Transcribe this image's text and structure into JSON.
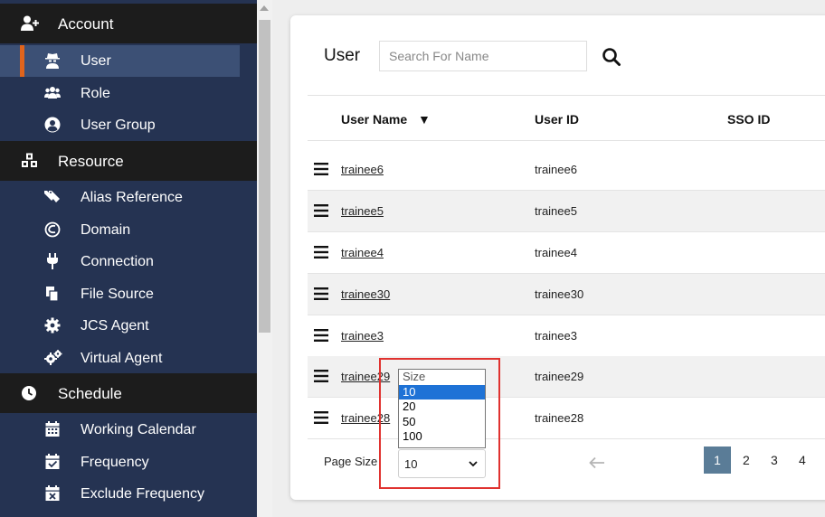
{
  "colors": {
    "sidebar": "#253352",
    "section_head": "#1c1c1c",
    "active_item": "#3c5075",
    "active_marker": "#e0641c",
    "page_active": "#5a7c97",
    "option_highlight": "#1e72d6",
    "annotation": "#e0322f"
  },
  "sidebar": {
    "sections": [
      {
        "label": "Account",
        "icon": "user-plus-icon"
      },
      {
        "label": "Resource",
        "icon": "cubes-icon"
      },
      {
        "label": "Schedule",
        "icon": "clock-icon"
      }
    ],
    "items": [
      {
        "label": "User",
        "icon": "user-secret-icon",
        "active": true
      },
      {
        "label": "Role",
        "icon": "users-icon"
      },
      {
        "label": "User Group",
        "icon": "user-circle-icon"
      },
      {
        "label": "Alias Reference",
        "icon": "tags-icon"
      },
      {
        "label": "Domain",
        "icon": "globe-icon"
      },
      {
        "label": "Connection",
        "icon": "plug-icon"
      },
      {
        "label": "File Source",
        "icon": "copy-icon"
      },
      {
        "label": "JCS Agent",
        "icon": "gear-icon"
      },
      {
        "label": "Virtual Agent",
        "icon": "gears-icon"
      },
      {
        "label": "Working Calendar",
        "icon": "calendar-icon"
      },
      {
        "label": "Frequency",
        "icon": "calendar-check-icon"
      },
      {
        "label": "Exclude Frequency",
        "icon": "calendar-times-icon"
      }
    ]
  },
  "main": {
    "title": "User",
    "search_placeholder": "Search For Name",
    "columns": {
      "user_name": "User Name",
      "sort_indicator": "▼",
      "user_id": "User ID",
      "sso_id": "SSO ID"
    },
    "rows": [
      {
        "name": "trainee6",
        "id": "trainee6"
      },
      {
        "name": "trainee5",
        "id": "trainee5"
      },
      {
        "name": "trainee4",
        "id": "trainee4"
      },
      {
        "name": "trainee30",
        "id": "trainee30"
      },
      {
        "name": "trainee3",
        "id": "trainee3"
      },
      {
        "name": "trainee29",
        "id": "trainee29"
      },
      {
        "name": "trainee28",
        "id": "trainee28"
      }
    ],
    "footer": {
      "page_size_label": "Page Size",
      "page_size_value": "10",
      "pages": [
        "1",
        "2",
        "3",
        "4"
      ],
      "current_page": "1"
    },
    "page_size_dropdown": {
      "options": [
        "Size",
        "10",
        "20",
        "50",
        "100"
      ],
      "highlighted": "10"
    }
  }
}
